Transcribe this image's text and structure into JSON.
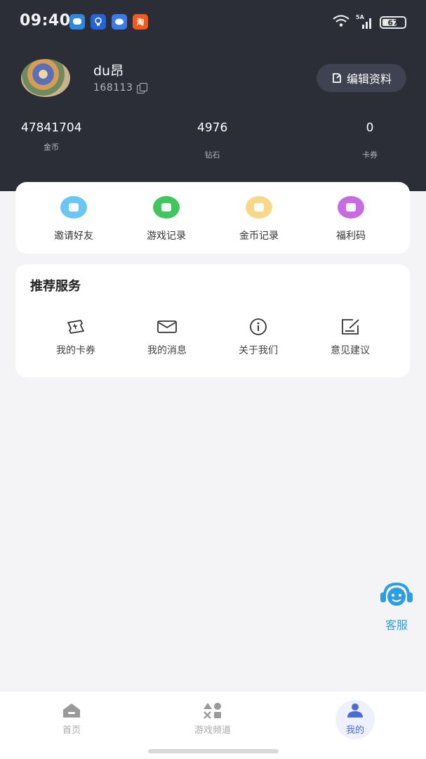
{
  "status_bar": {
    "time": "09:40",
    "notifications": [
      "message-icon",
      "bulb-icon",
      "chat-icon",
      "taobao-icon"
    ],
    "taobao_glyph": "淘",
    "signal_label": "5A",
    "battery": "67",
    "battery_level": 0.67
  },
  "profile": {
    "username": "du昂",
    "user_id": "168113",
    "edit_label": "编辑资料"
  },
  "stats": [
    {
      "value": "47841704",
      "label": "金币"
    },
    {
      "value": "4976",
      "label": "钻石"
    },
    {
      "value": "0",
      "label": "卡券"
    }
  ],
  "quick_actions": [
    {
      "label": "邀请好友",
      "icon": "invite-icon",
      "color": "#6cc6f4"
    },
    {
      "label": "游戏记录",
      "icon": "game-record-icon",
      "color": "#3fc65d"
    },
    {
      "label": "金币记录",
      "icon": "coin-record-icon",
      "color": "#f7d789"
    },
    {
      "label": "福利码",
      "icon": "gift-code-icon",
      "color": "#c86ae2"
    }
  ],
  "services": {
    "title": "推荐服务",
    "items": [
      {
        "label": "我的卡券",
        "icon": "ticket-icon"
      },
      {
        "label": "我的消息",
        "icon": "envelope-icon"
      },
      {
        "label": "关于我们",
        "icon": "info-icon"
      },
      {
        "label": "意见建议",
        "icon": "feedback-icon"
      }
    ]
  },
  "customer_service": {
    "label": "客服"
  },
  "tabbar": {
    "tabs": [
      {
        "label": "首页",
        "icon": "home-icon"
      },
      {
        "label": "游戏频道",
        "icon": "game-channel-icon"
      },
      {
        "label": "我的",
        "icon": "profile-icon",
        "active": true
      }
    ]
  },
  "colors": {
    "header_bg": "#2b2d37",
    "accent": "#4b6bd8",
    "cs_blue": "#2d9ee3"
  }
}
